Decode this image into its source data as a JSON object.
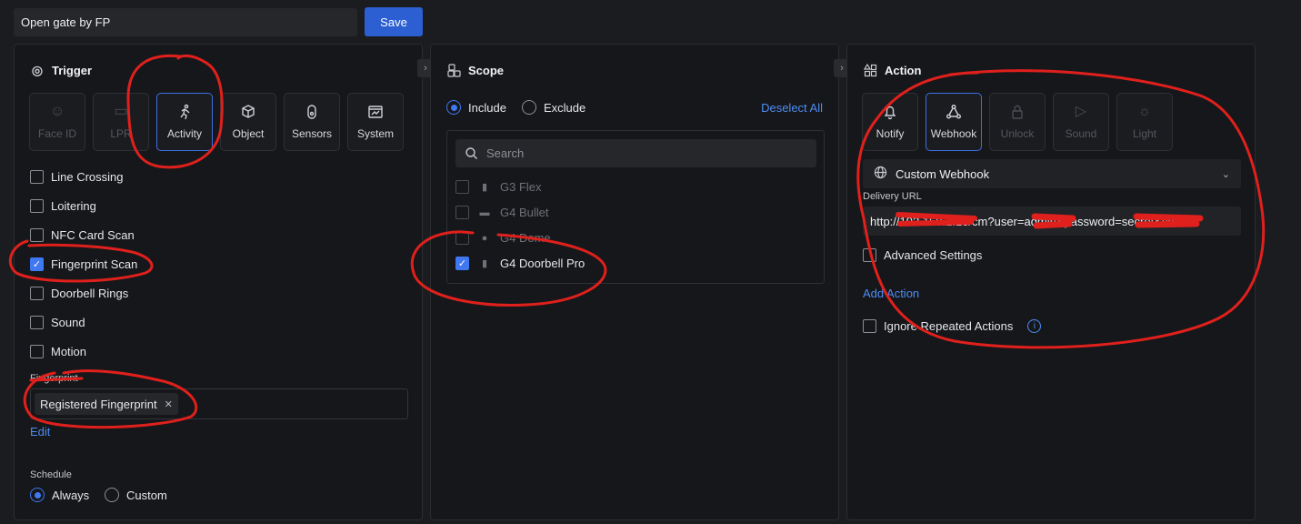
{
  "topbar": {
    "rule_name": "Open gate by FP",
    "save_label": "Save"
  },
  "trigger": {
    "title": "Trigger",
    "tiles": [
      {
        "label": "Face ID",
        "icon": "face-id-icon",
        "state": "disabled"
      },
      {
        "label": "LPR",
        "icon": "license-plate-icon",
        "state": "disabled"
      },
      {
        "label": "Activity",
        "icon": "running-person-icon",
        "state": "selected"
      },
      {
        "label": "Object",
        "icon": "cube-icon",
        "state": "normal"
      },
      {
        "label": "Sensors",
        "icon": "sensor-icon",
        "state": "normal"
      },
      {
        "label": "System",
        "icon": "system-icon",
        "state": "normal"
      }
    ],
    "activities": [
      {
        "label": "Line Crossing",
        "checked": false
      },
      {
        "label": "Loitering",
        "checked": false
      },
      {
        "label": "NFC Card Scan",
        "checked": false
      },
      {
        "label": "Fingerprint Scan",
        "checked": true
      },
      {
        "label": "Doorbell Rings",
        "checked": false
      },
      {
        "label": "Sound",
        "checked": false
      },
      {
        "label": "Motion",
        "checked": false
      }
    ],
    "fingerprint_label": "Fingerprint",
    "fingerprint_token": "Registered Fingerprint",
    "edit_label": "Edit",
    "schedule_label": "Schedule",
    "schedule_options": [
      "Always",
      "Custom"
    ],
    "schedule_selected": "Always"
  },
  "scope": {
    "title": "Scope",
    "mode_options": [
      "Include",
      "Exclude"
    ],
    "mode_selected": "Include",
    "deselect_label": "Deselect All",
    "search_placeholder": "Search",
    "devices": [
      {
        "label": "G3 Flex",
        "checked": false
      },
      {
        "label": "G4 Bullet",
        "checked": false
      },
      {
        "label": "G4 Dome",
        "checked": false
      },
      {
        "label": "G4 Doorbell Pro",
        "checked": true
      }
    ]
  },
  "action": {
    "title": "Action",
    "tiles": [
      {
        "label": "Notify",
        "icon": "bell-icon",
        "state": "normal"
      },
      {
        "label": "Webhook",
        "icon": "webhook-icon",
        "state": "selected"
      },
      {
        "label": "Unlock",
        "icon": "lock-icon",
        "state": "disabled"
      },
      {
        "label": "Sound",
        "icon": "play-icon",
        "state": "disabled"
      },
      {
        "label": "Light",
        "icon": "light-bulb-icon",
        "state": "disabled"
      }
    ],
    "webhook_type": "Custom Webhook",
    "delivery_url_label": "Delivery URL",
    "delivery_url": "http://192.168.1.10/cm?user=admin&password=secret&cmnd",
    "advanced_label": "Advanced Settings",
    "add_action_label": "Add Action",
    "ignore_label": "Ignore Repeated Actions"
  },
  "colors": {
    "accent": "#3f78f0",
    "link": "#4d8df5",
    "annotation": "#e0201c"
  }
}
